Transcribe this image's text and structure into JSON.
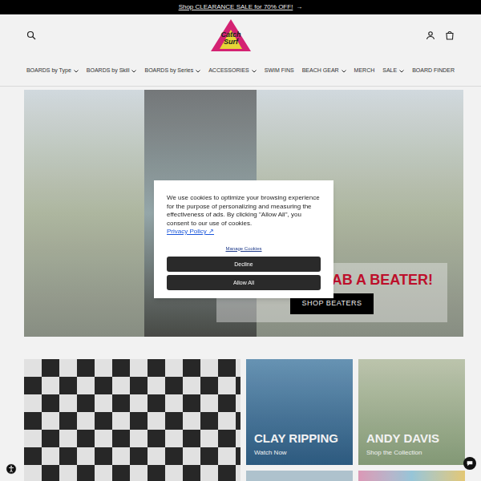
{
  "announcement": {
    "text": "Shop CLEARANCE SALE for 70% OFF!",
    "arrow": "→"
  },
  "logo": {
    "text": "Catch Surf"
  },
  "nav": [
    {
      "label": "BOARDS by Type",
      "dropdown": true
    },
    {
      "label": "BOARDS by Skill",
      "dropdown": true
    },
    {
      "label": "BOARDS by Series",
      "dropdown": true
    },
    {
      "label": "ACCESSORIES",
      "dropdown": true
    },
    {
      "label": "SWIM FINS",
      "dropdown": false
    },
    {
      "label": "BEACH GEAR",
      "dropdown": true
    },
    {
      "label": "MERCH",
      "dropdown": false
    },
    {
      "label": "SALE",
      "dropdown": true
    },
    {
      "label": "BOARD FINDER",
      "dropdown": false
    }
  ],
  "hero": {
    "headline": "GRAB A BEATER!",
    "button": "SHOP BEATERS"
  },
  "tiles": [
    {
      "title": "CLAY RIPPING",
      "subtitle": "Watch Now"
    },
    {
      "title": "ANDY DAVIS",
      "subtitle": "Shop the Collection"
    }
  ],
  "cookie": {
    "text": "We use cookies to optimize your browsing experience for the purpose of personalizing and measuring the effectiveness of ads. By clicking \"Allow All\", you consent to our use of cookies.",
    "link": "Privacy Policy ↗",
    "manage": "Manage Cookies",
    "buttons": [
      "Decline",
      "Allow All"
    ]
  }
}
